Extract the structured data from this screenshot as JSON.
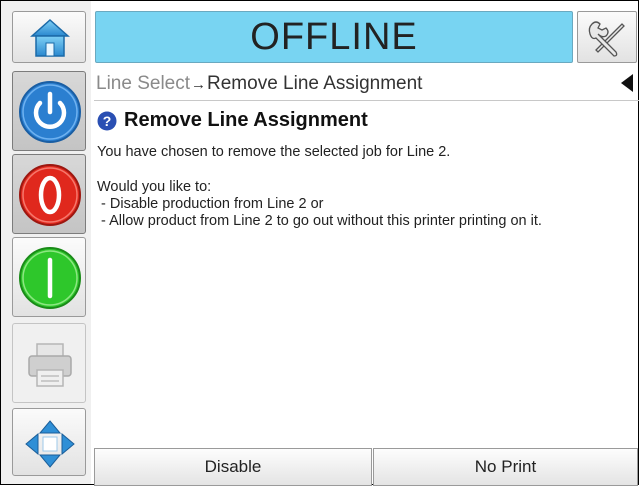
{
  "header": {
    "status_title": "OFFLINE",
    "home_icon": "home-icon",
    "settings_icon": "wrench-screwdriver-icon"
  },
  "sidebar": {
    "buttons": [
      {
        "name": "power",
        "icon": "power-icon",
        "color": "#2b7fd0"
      },
      {
        "name": "stop",
        "icon": "stop-icon",
        "color": "#e0281d"
      },
      {
        "name": "start",
        "icon": "start-icon",
        "color": "#2ec72b"
      },
      {
        "name": "print",
        "icon": "printer-icon",
        "color": "#b0b0b0"
      },
      {
        "name": "navigate",
        "icon": "four-way-arrow-icon",
        "color": "#2f8fd6"
      }
    ]
  },
  "breadcrumb": {
    "parent": "Line Select",
    "separator": "→",
    "current": "Remove Line Assignment"
  },
  "dialog": {
    "title": "Remove Line Assignment",
    "line1": "You have chosen to remove the selected job for Line 2.",
    "prompt": "Would you like to:",
    "option1": " - Disable production from Line 2 or",
    "option2": " - Allow product from Line 2 to go out without this printer printing on it."
  },
  "footer": {
    "disable_label": "Disable",
    "noprint_label": "No Print"
  }
}
